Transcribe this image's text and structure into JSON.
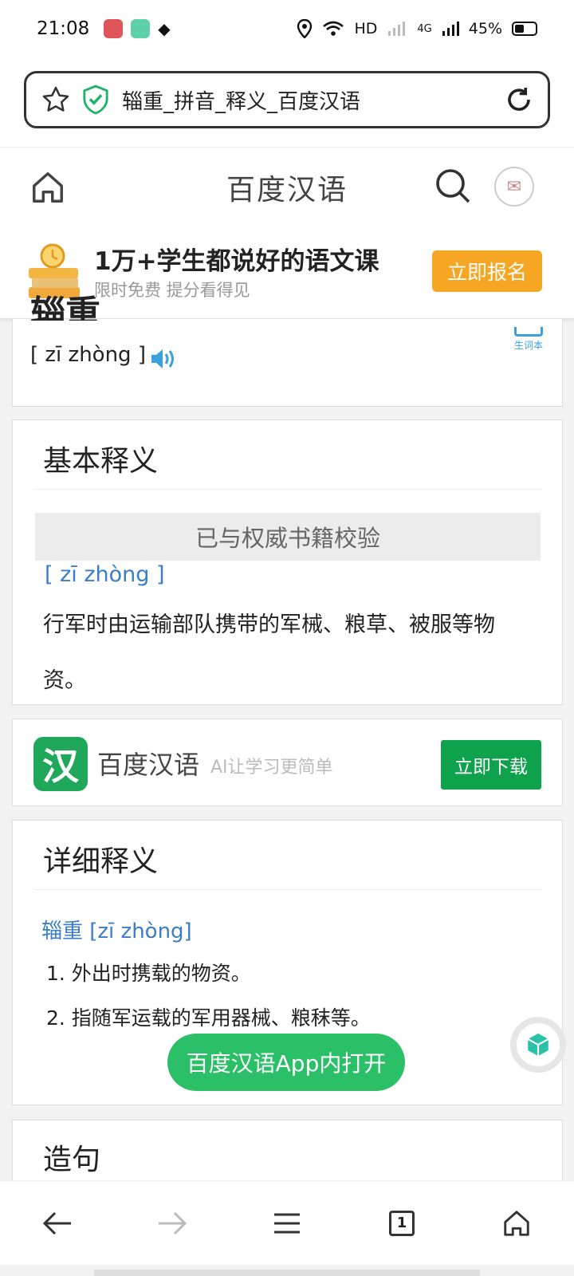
{
  "status_bar": {
    "time": "21:08",
    "network_label": "HD",
    "signal_label": "4G",
    "battery": "45%"
  },
  "url_bar": {
    "page_title": "辎重_拼音_释义_百度汉语"
  },
  "header": {
    "site_title": "百度汉语"
  },
  "promo": {
    "title": "1万+学生都说好的语文课",
    "subtitle": "限时免费 提分看得见",
    "button": "立即报名"
  },
  "word": {
    "head_word": "辎重",
    "pinyin": "[ zī zhòng ]",
    "vocab_book_label": "生词本"
  },
  "basic_definition": {
    "title": "基本释义",
    "verified_label": "已与权威书籍校验",
    "pinyin": "[ zī zhòng ]",
    "text": "行军时由运输部队携带的军械、粮草、被服等物资。"
  },
  "app_banner": {
    "name": "百度汉语",
    "slogan": "AI让学习更简单",
    "download_button": "立即下载",
    "logo_char": "汉"
  },
  "detailed_definition": {
    "title": "详细释义",
    "word_pinyin": "辎重 [zī zhòng]",
    "items": [
      "1. 外出时携载的物资。",
      "2. 指随军运载的军用器械、粮秣等。"
    ]
  },
  "open_in_app": "百度汉语App内打开",
  "sentences": {
    "title": "造句"
  },
  "bottom_nav": {
    "tab_count": "1"
  },
  "colors": {
    "brand_green": "#0fa24d",
    "promo_orange": "#f5a623",
    "link_blue": "#3a7dc9"
  }
}
